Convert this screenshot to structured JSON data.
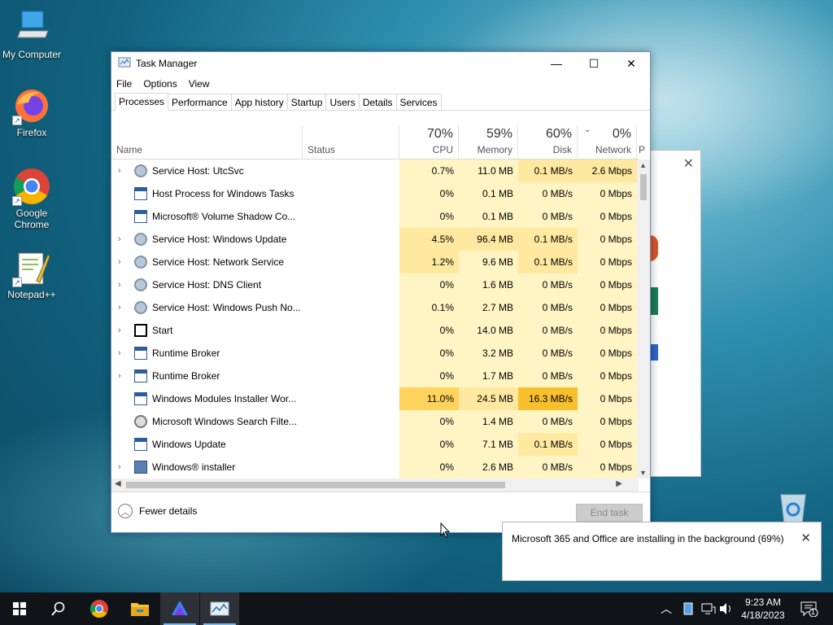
{
  "desktop": {
    "icons": [
      {
        "label": "My Computer",
        "icon": "computer-icon"
      },
      {
        "label": "Firefox",
        "icon": "firefox-icon"
      },
      {
        "label": "Google Chrome",
        "icon": "chrome-icon"
      },
      {
        "label": "Notepad++",
        "icon": "notepadpp-icon"
      }
    ]
  },
  "taskmanager": {
    "title": "Task Manager",
    "menu": [
      "File",
      "Options",
      "View"
    ],
    "tabs": [
      "Processes",
      "Performance",
      "App history",
      "Startup",
      "Users",
      "Details",
      "Services"
    ],
    "active_tab": "Processes",
    "columns": {
      "name": "Name",
      "status": "Status",
      "cpu": {
        "pct": "70%",
        "label": "CPU"
      },
      "memory": {
        "pct": "59%",
        "label": "Memory"
      },
      "disk": {
        "pct": "60%",
        "label": "Disk"
      },
      "network": {
        "pct": "0%",
        "label": "Network"
      },
      "next": "P"
    },
    "rows": [
      {
        "name": "Service Host: UtcSvc",
        "cpu": "0.7%",
        "memory": "11.0 MB",
        "disk": "0.1 MB/s",
        "network": "2.6 Mbps",
        "expand": true,
        "icon": "gear-icon"
      },
      {
        "name": "Host Process for Windows Tasks",
        "cpu": "0%",
        "memory": "0.1 MB",
        "disk": "0 MB/s",
        "network": "0 Mbps",
        "expand": false,
        "icon": "window-icon"
      },
      {
        "name": "Microsoft® Volume Shadow Co...",
        "cpu": "0%",
        "memory": "0.1 MB",
        "disk": "0 MB/s",
        "network": "0 Mbps",
        "expand": false,
        "icon": "window-icon"
      },
      {
        "name": "Service Host: Windows Update",
        "cpu": "4.5%",
        "memory": "96.4 MB",
        "disk": "0.1 MB/s",
        "network": "0 Mbps",
        "expand": true,
        "icon": "gear-icon"
      },
      {
        "name": "Service Host: Network Service",
        "cpu": "1.2%",
        "memory": "9.6 MB",
        "disk": "0.1 MB/s",
        "network": "0 Mbps",
        "expand": true,
        "icon": "gear-icon"
      },
      {
        "name": "Service Host: DNS Client",
        "cpu": "0%",
        "memory": "1.6 MB",
        "disk": "0 MB/s",
        "network": "0 Mbps",
        "expand": true,
        "icon": "gear-icon"
      },
      {
        "name": "Service Host: Windows Push No...",
        "cpu": "0.1%",
        "memory": "2.7 MB",
        "disk": "0 MB/s",
        "network": "0 Mbps",
        "expand": true,
        "icon": "gear-icon"
      },
      {
        "name": "Start",
        "cpu": "0%",
        "memory": "14.0 MB",
        "disk": "0 MB/s",
        "network": "0 Mbps",
        "expand": true,
        "icon": "start-icon"
      },
      {
        "name": "Runtime Broker",
        "cpu": "0%",
        "memory": "3.2 MB",
        "disk": "0 MB/s",
        "network": "0 Mbps",
        "expand": true,
        "icon": "window-icon"
      },
      {
        "name": "Runtime Broker",
        "cpu": "0%",
        "memory": "1.7 MB",
        "disk": "0 MB/s",
        "network": "0 Mbps",
        "expand": true,
        "icon": "window-icon"
      },
      {
        "name": "Windows Modules Installer Wor...",
        "cpu": "11.0%",
        "memory": "24.5 MB",
        "disk": "16.3 MB/s",
        "network": "0 Mbps",
        "expand": false,
        "icon": "window-icon"
      },
      {
        "name": "Microsoft Windows Search Filte...",
        "cpu": "0%",
        "memory": "1.4 MB",
        "disk": "0 MB/s",
        "network": "0 Mbps",
        "expand": false,
        "icon": "search-filter-icon"
      },
      {
        "name": "Windows Update",
        "cpu": "0%",
        "memory": "7.1 MB",
        "disk": "0.1 MB/s",
        "network": "0 Mbps",
        "expand": false,
        "icon": "window-icon"
      },
      {
        "name": "Windows® installer",
        "cpu": "0%",
        "memory": "2.6 MB",
        "disk": "0 MB/s",
        "network": "0 Mbps",
        "expand": true,
        "icon": "installer-icon"
      }
    ],
    "fewer_details": "Fewer details",
    "end_task": "End task"
  },
  "notification": {
    "message": "Microsoft 365 and Office are installing in the background (69%)",
    "progress_percent": 69
  },
  "taskbar": {
    "apps": [
      "start-icon",
      "search-icon",
      "chrome-icon",
      "file-explorer-icon",
      "app-icon",
      "task-manager-icon"
    ],
    "clock_time": "9:23 AM",
    "clock_date": "4/18/2023",
    "notification_count": "1"
  },
  "colors": {
    "heat_low": "#fff4c4",
    "heat_mid": "#ffe9a0",
    "heat_high": "#ffd35c",
    "heat_max": "#f9c02d"
  }
}
